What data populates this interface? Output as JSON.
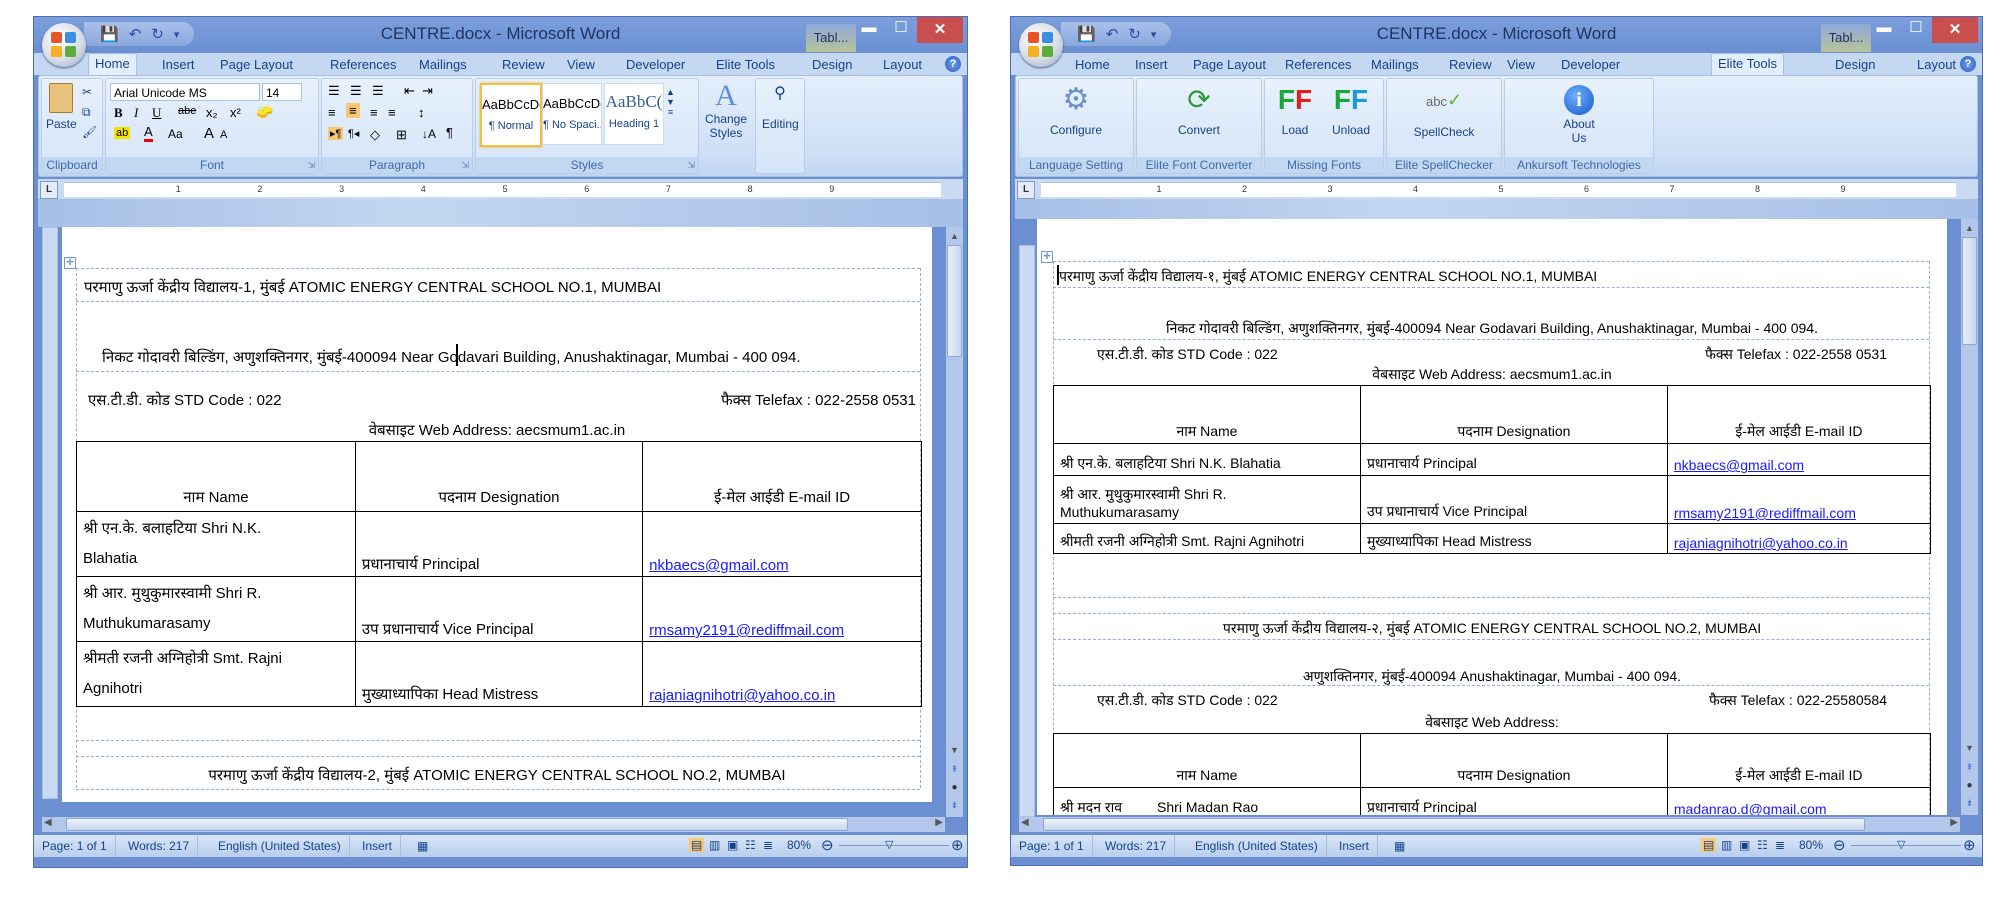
{
  "windows": [
    {
      "id": "left",
      "title": "CENTRE.docx - Microsoft Word",
      "contextual_tab": "Tabl...",
      "active_tab": "Home",
      "tabs": [
        "Home",
        "Insert",
        "Page Layout",
        "References",
        "Mailings",
        "Review",
        "View",
        "Developer",
        "Elite Tools",
        "Design",
        "Layout"
      ],
      "ribbon_home": {
        "clipboard": {
          "label": "Clipboard",
          "paste": "Paste"
        },
        "font": {
          "label": "Font",
          "font_name": "Arial Unicode MS",
          "font_size": "14",
          "bold": "B",
          "italic": "I",
          "underline": "U",
          "strike": "abe",
          "subscript": "x₂",
          "superscript": "x²",
          "change_case": "Aa",
          "grow": "A",
          "shrink": "A"
        },
        "paragraph": {
          "label": "Paragraph",
          "pilcrow": "¶"
        },
        "styles": {
          "label": "Styles",
          "items": [
            {
              "preview": "AaBbCcDc",
              "name": "¶ Normal"
            },
            {
              "preview": "AaBbCcDc",
              "name": "¶ No Spaci..."
            },
            {
              "preview": "AaBbC(",
              "name": "Heading 1"
            }
          ],
          "change_styles": "Change Styles"
        },
        "editing": {
          "label": "Editing"
        }
      },
      "document": {
        "school_title": "परमाणु ऊर्जा केंद्रीय विद्यालय-1, मुंबई  ATOMIC ENERGY CENTRAL SCHOOL NO.1, MUMBAI",
        "address": "निकट गोदावरी बिल्डिंग, अणुशक्तिनगर, मुंबई-400094  Near Godavari Building, Anushaktinagar, Mumbai - 400 094.",
        "std_code": "एस.टी.डी. कोड STD Code : 022",
        "telefax": "फैक्स Telefax : 022-2558 0531",
        "web": "वेबसाइट Web Address: aecsmum1.ac.in",
        "table_headers": [
          "नाम Name",
          "पदनाम Designation",
          "ई-मेल आईडी E-mail ID"
        ],
        "rows": [
          {
            "name_l1": "श्री एन.के. बलाहटिया    Shri N.K.",
            "name_l2": "Blahatia",
            "designation": "प्रधानाचार्य Principal",
            "email": "nkbaecs@gmail.com"
          },
          {
            "name_l1": "श्री आर. मुथुकुमारस्वामी    Shri R.",
            "name_l2": "Muthukumarasamy",
            "designation": "उप प्रधानाचार्य     Vice Principal",
            "email": "rmsamy2191@rediffmail.com"
          },
          {
            "name_l1": "श्रीमती रजनी अग्निहोत्री Smt. Rajni",
            "name_l2": "Agnihotri",
            "designation": "मुख्याध्यापिका    Head Mistress",
            "email": "rajaniagnihotri@yahoo.co.in"
          }
        ],
        "school2_title": "परमाणु ऊर्जा केंद्रीय विद्यालय-2, मुंबई  ATOMIC ENERGY CENTRAL SCHOOL NO.2, MUMBAI"
      },
      "status": {
        "page": "Page: 1 of 1",
        "words": "Words: 217",
        "language": "English (United States)",
        "mode": "Insert",
        "zoom": "80%"
      }
    },
    {
      "id": "right",
      "title": "CENTRE.docx - Microsoft Word",
      "contextual_tab": "Tabl...",
      "active_tab": "Elite Tools",
      "tabs": [
        "Home",
        "Insert",
        "Page Layout",
        "References",
        "Mailings",
        "Review",
        "View",
        "Developer",
        "Elite Tools",
        "Design",
        "Layout"
      ],
      "ribbon_elite": {
        "groups": [
          {
            "label": "Language Setting",
            "buttons": [
              {
                "label": "Configure",
                "icon": "gear-icon"
              }
            ]
          },
          {
            "label": "Elite Font Converter",
            "buttons": [
              {
                "label": "Convert",
                "icon": "refresh-icon"
              }
            ]
          },
          {
            "label": "Missing Fonts",
            "buttons": [
              {
                "label": "Load",
                "icon": "font-load-icon"
              },
              {
                "label": "Unload",
                "icon": "font-unload-icon"
              }
            ]
          },
          {
            "label": "Elite SpellChecker",
            "buttons": [
              {
                "label": "SpellCheck",
                "icon": "spellcheck-icon"
              }
            ]
          },
          {
            "label": "Ankursoft Technologies",
            "buttons": [
              {
                "label": "About Us",
                "icon": "info-icon"
              }
            ]
          }
        ]
      },
      "document": {
        "school_title": "परमाणु ऊर्जा केंद्रीय विद्यालय-१, मुंबई  ATOMIC ENERGY CENTRAL SCHOOL NO.1, MUMBAI",
        "address": "निकट गोदावरी बिल्डिंग, अणुशक्तिनगर, मुंबई-400094  Near Godavari Building, Anushaktinagar, Mumbai - 400 094.",
        "std_code": "एस.टी.डी. कोड STD Code : 022",
        "telefax": "फैक्स Telefax : 022-2558 0531",
        "web": "वेबसाइट Web Address: aecsmum1.ac.in",
        "table_headers": [
          "नाम Name",
          "पदनाम Designation",
          "ई-मेल आईडी E-mail ID"
        ],
        "rows": [
          {
            "name_l1": "श्री एन.के. बलाहटिया    Shri N.K. Blahatia",
            "name_l2": "",
            "designation": "प्रधानाचार्य Principal",
            "email": "nkbaecs@gmail.com"
          },
          {
            "name_l1": "श्री आर. मुथुकुमारस्वामी    Shri R.",
            "name_l2": "Muthukumarasamy",
            "designation": "उप प्रधानाचार्य     Vice Principal",
            "email": "rmsamy2191@rediffmail.com"
          },
          {
            "name_l1": "श्रीमती रजनी अग्निहोत्री  Smt. Rajni Agnihotri",
            "name_l2": "",
            "designation": "मुख्याध्यापिका    Head Mistress",
            "email": "rajaniagnihotri@yahoo.co.in"
          }
        ],
        "school2_title": "परमाणु ऊर्जा केंद्रीय विद्यालय-२, मुंबई  ATOMIC ENERGY CENTRAL SCHOOL NO.2, MUMBAI",
        "school2_address": "अणुशक्तिनगर, मुंबई-400094 Anushaktinagar, Mumbai - 400 094.",
        "school2_std_code": "एस.टी.डी. कोड STD Code : 022",
        "school2_telefax": "फैक्स Telefax : 022-25580584",
        "school2_web": "वेबसाइट Web Address:",
        "school2_headers": [
          "नाम Name",
          "पदनाम Designation",
          "ई-मेल आईडी E-mail ID"
        ],
        "school2_rows": [
          {
            "name_hi": "श्री मदन राव",
            "name_en": "Shri Madan Rao",
            "designation": "प्रधानाचार्य Principal",
            "email": "madanrao.d@gmail.com"
          }
        ]
      },
      "status": {
        "page": "Page: 1 of 1",
        "words": "Words: 217",
        "language": "English (United States)",
        "mode": "Insert",
        "zoom": "80%"
      }
    }
  ],
  "ruler_numbers": [
    "1",
    "2",
    "3",
    "4",
    "5",
    "6",
    "7",
    "8",
    "9"
  ],
  "colors": {
    "titlebar": "#6a8fd2",
    "close": "#c94f4f",
    "ribbon": "#dbe8f9",
    "link": "#1a1aff",
    "tab_text": "#15428b"
  }
}
